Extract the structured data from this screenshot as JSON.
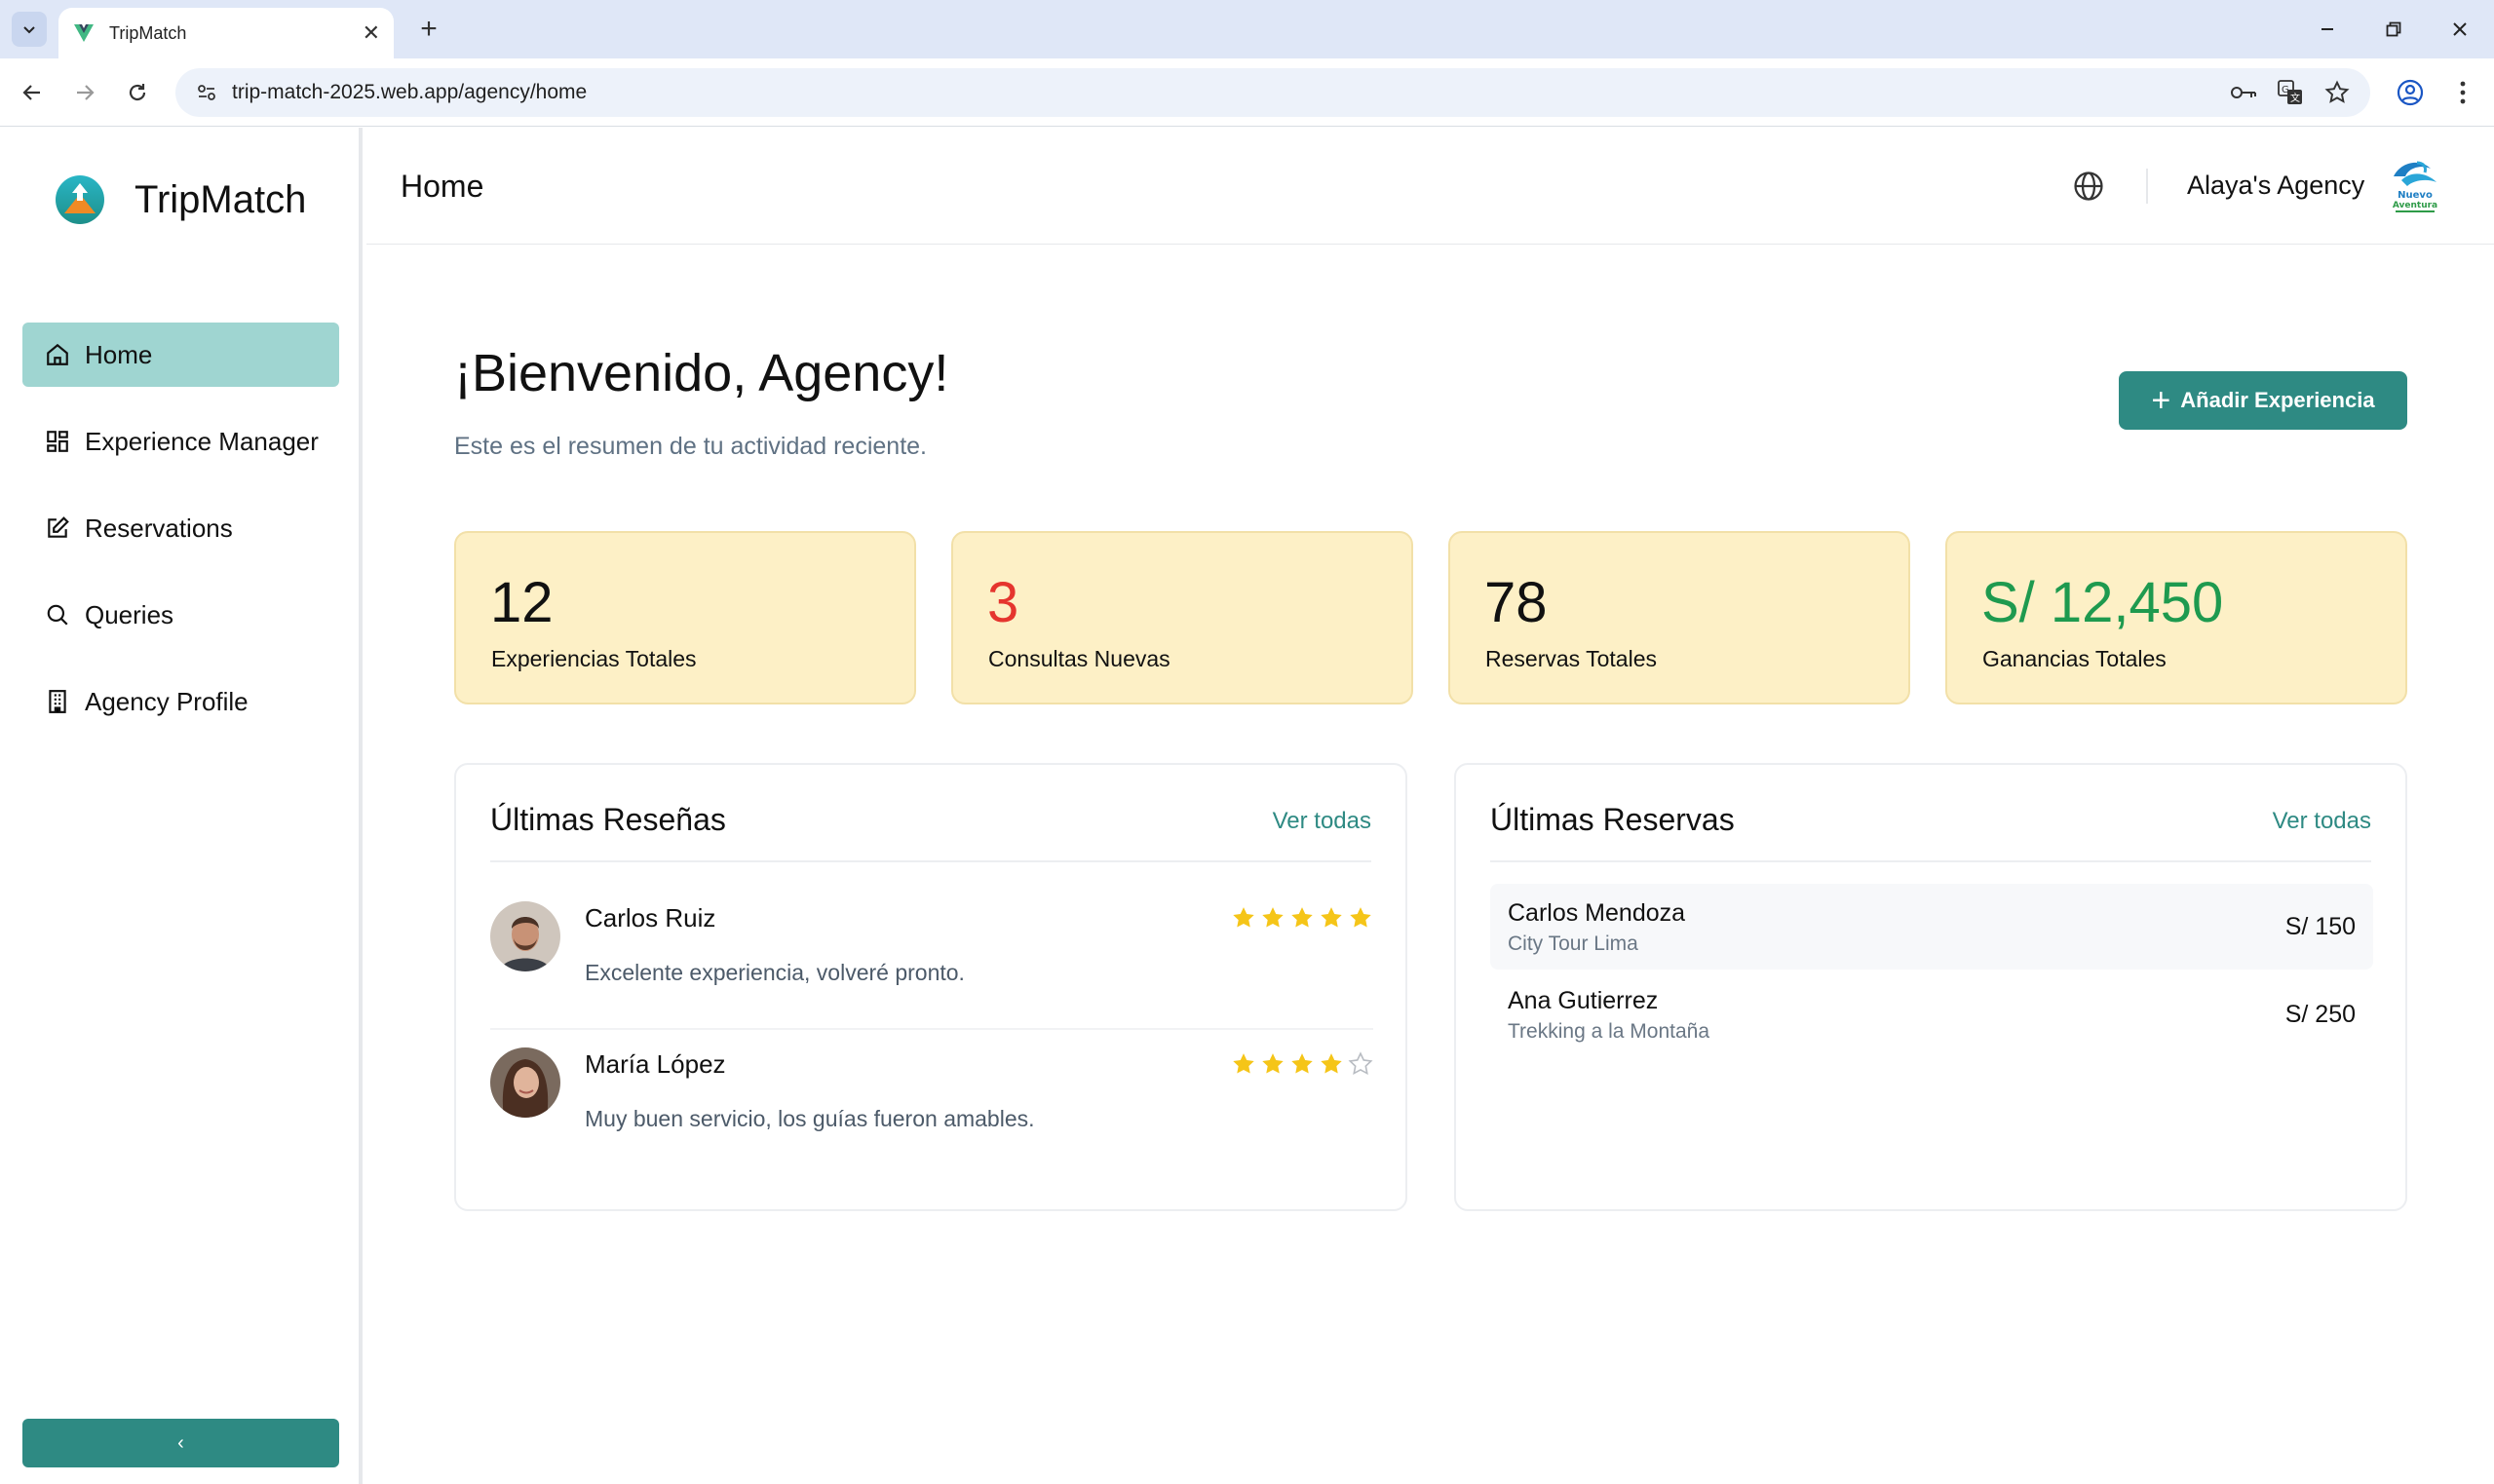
{
  "browser": {
    "tab_title": "TripMatch",
    "url": "trip-match-2025.web.app/agency/home"
  },
  "sidebar": {
    "brand": "TripMatch",
    "items": [
      {
        "label": "Home",
        "icon": "home-icon",
        "active": true
      },
      {
        "label": "Experience Manager",
        "icon": "grid-icon",
        "active": false
      },
      {
        "label": "Reservations",
        "icon": "edit-icon",
        "active": false
      },
      {
        "label": "Queries",
        "icon": "search-icon",
        "active": false
      },
      {
        "label": "Agency Profile",
        "icon": "building-icon",
        "active": false
      }
    ],
    "collapse_label": "‹"
  },
  "header": {
    "title": "Home",
    "agency_name": "Alaya's Agency",
    "agency_logo_text": "Nuevo Aventura"
  },
  "main": {
    "welcome": "¡Bienvenido, Agency!",
    "subtitle": "Este es el resumen de tu actividad reciente.",
    "add_button": "Añadir Experiencia",
    "stats": [
      {
        "value": "12",
        "label": "Experiencias Totales",
        "color": "#111111"
      },
      {
        "value": "3",
        "label": "Consultas Nuevas",
        "color": "#e5352e"
      },
      {
        "value": "78",
        "label": "Reservas Totales",
        "color": "#111111"
      },
      {
        "value": "S/ 12,450",
        "label": "Ganancias Totales",
        "color": "#1e9a4f"
      }
    ],
    "reviews": {
      "title": "Últimas Reseñas",
      "link": "Ver todas",
      "items": [
        {
          "name": "Carlos Ruiz",
          "text": "Excelente experiencia, volveré pronto.",
          "rating": 5
        },
        {
          "name": "María López",
          "text": "Muy buen servicio, los guías fueron amables.",
          "rating": 4
        }
      ]
    },
    "reservations": {
      "title": "Últimas Reservas",
      "link": "Ver todas",
      "items": [
        {
          "name": "Carlos Mendoza",
          "experience": "City Tour Lima",
          "amount": "S/ 150"
        },
        {
          "name": "Ana Gutierrez",
          "experience": "Trekking a la Montaña",
          "amount": "S/ 250"
        }
      ]
    }
  },
  "colors": {
    "accent": "#2e8a83",
    "active_nav": "#9fd5d1",
    "stat_bg": "#fdf0c6",
    "star": "#f5c518"
  }
}
